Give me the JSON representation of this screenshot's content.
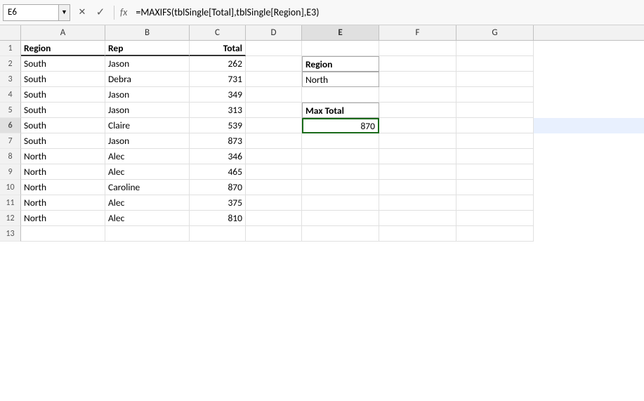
{
  "formulaBar": {
    "cellRef": "E6",
    "formula": "=MAXIFS(tblSingle[Total],tblSingle[Region],E3)"
  },
  "columns": [
    "A",
    "B",
    "C",
    "D",
    "E",
    "F",
    "G"
  ],
  "rows": [
    {
      "num": 1,
      "a": "Region",
      "b": "Rep",
      "c": "Total",
      "d": "",
      "e": "",
      "f": "",
      "g": ""
    },
    {
      "num": 2,
      "a": "South",
      "b": "Jason",
      "c": "262",
      "d": "",
      "e": "",
      "f": "",
      "g": ""
    },
    {
      "num": 3,
      "a": "South",
      "b": "Debra",
      "c": "731",
      "d": "",
      "e": "North",
      "f": "",
      "g": ""
    },
    {
      "num": 4,
      "a": "South",
      "b": "Jason",
      "c": "349",
      "d": "",
      "e": "",
      "f": "",
      "g": ""
    },
    {
      "num": 5,
      "a": "South",
      "b": "Jason",
      "c": "313",
      "d": "",
      "e": "",
      "f": "",
      "g": ""
    },
    {
      "num": 6,
      "a": "South",
      "b": "Claire",
      "c": "539",
      "d": "",
      "e": "870",
      "f": "",
      "g": ""
    },
    {
      "num": 7,
      "a": "South",
      "b": "Jason",
      "c": "873",
      "d": "",
      "e": "",
      "f": "",
      "g": ""
    },
    {
      "num": 8,
      "a": "North",
      "b": "Alec",
      "c": "346",
      "d": "",
      "e": "",
      "f": "",
      "g": ""
    },
    {
      "num": 9,
      "a": "North",
      "b": "Alec",
      "c": "465",
      "d": "",
      "e": "",
      "f": "",
      "g": ""
    },
    {
      "num": 10,
      "a": "North",
      "b": "Caroline",
      "c": "870",
      "d": "",
      "e": "",
      "f": "",
      "g": ""
    },
    {
      "num": 11,
      "a": "North",
      "b": "Alec",
      "c": "375",
      "d": "",
      "e": "",
      "f": "",
      "g": ""
    },
    {
      "num": 12,
      "a": "North",
      "b": "Alec",
      "c": "810",
      "d": "",
      "e": "",
      "f": "",
      "g": ""
    },
    {
      "num": 13,
      "a": "",
      "b": "",
      "c": "",
      "d": "",
      "e": "",
      "f": "",
      "g": ""
    }
  ],
  "lookupLabels": {
    "regionLabel": "Region",
    "maxTotalLabel": "Max Total"
  }
}
